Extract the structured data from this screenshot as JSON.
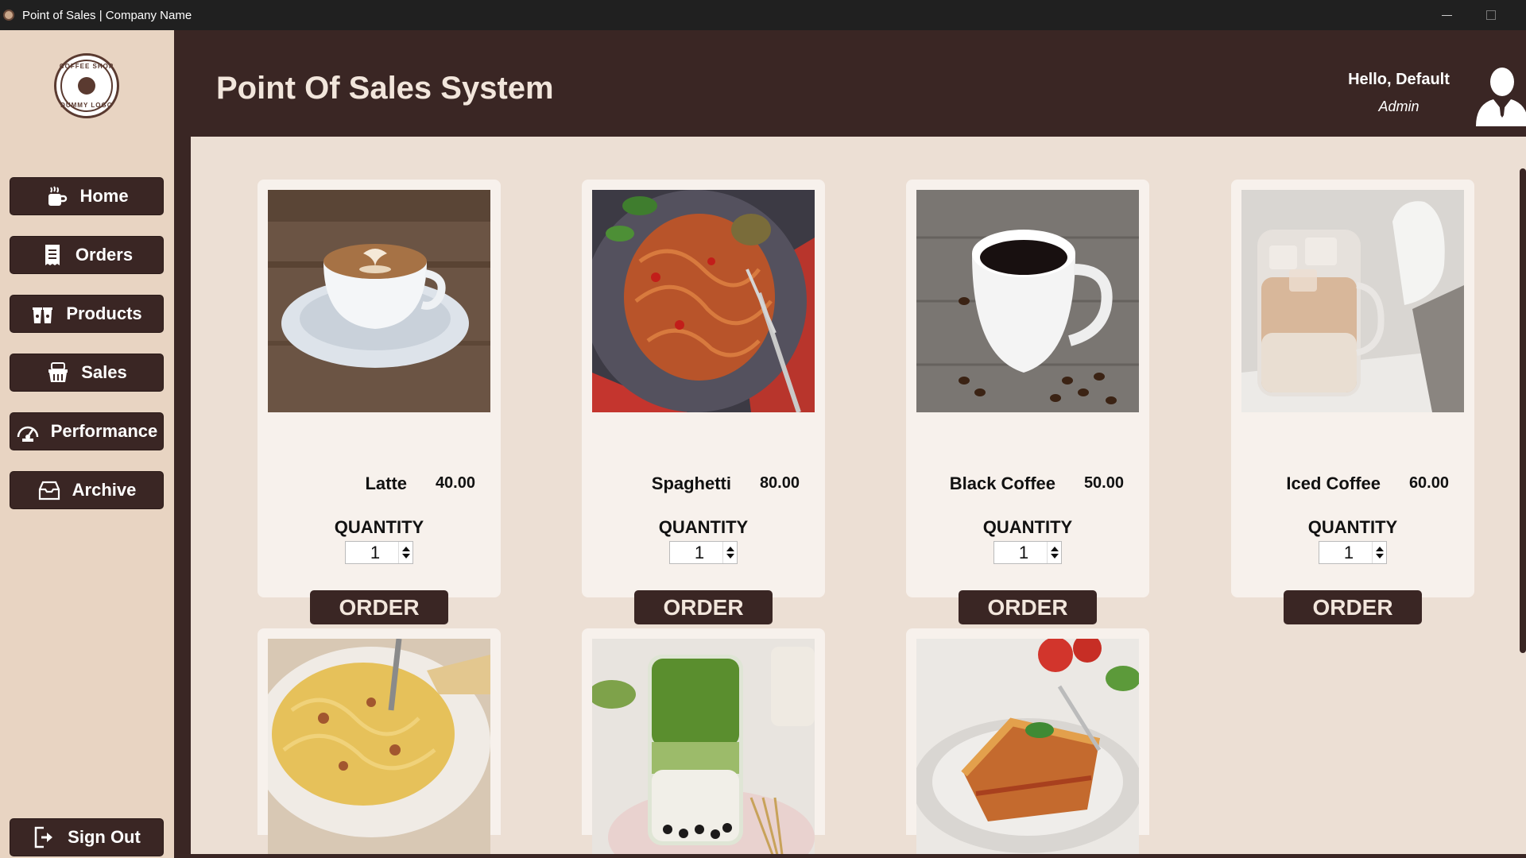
{
  "window": {
    "title": "Point of Sales | Company Name"
  },
  "logo": {
    "top_text": "COFFEE SHOP",
    "bottom_text": "DUMMY LOGO"
  },
  "sidebar": {
    "items": [
      {
        "label": "Home",
        "icon": "coffee-cup-icon"
      },
      {
        "label": "Orders",
        "icon": "receipt-icon"
      },
      {
        "label": "Products",
        "icon": "drinks-icon"
      },
      {
        "label": "Sales",
        "icon": "basket-icon"
      },
      {
        "label": "Performance",
        "icon": "gauge-icon"
      },
      {
        "label": "Archive",
        "icon": "archive-box-icon"
      }
    ],
    "signout": {
      "label": "Sign Out",
      "icon": "sign-out-icon"
    }
  },
  "header": {
    "title": "Point Of Sales System",
    "greeting": "Hello, Default",
    "role": "Admin",
    "avatar_icon": "user-avatar-icon"
  },
  "products": [
    {
      "name": "Latte",
      "price": "40.00",
      "qty_label": "QUANTITY",
      "qty": "1",
      "order_label": "ORDER"
    },
    {
      "name": "Spaghetti",
      "price": "80.00",
      "qty_label": "QUANTITY",
      "qty": "1",
      "order_label": "ORDER"
    },
    {
      "name": "Black Coffee",
      "price": "50.00",
      "qty_label": "QUANTITY",
      "qty": "1",
      "order_label": "ORDER"
    },
    {
      "name": "Iced Coffee",
      "price": "60.00",
      "qty_label": "QUANTITY",
      "qty": "1",
      "order_label": "ORDER"
    },
    {
      "image": "carbonara-pasta"
    },
    {
      "image": "matcha-boba"
    },
    {
      "image": "lasagna"
    }
  ],
  "colors": {
    "primary_dark": "#3a2624",
    "sidebar_bg": "#e8d4c2",
    "main_bg": "#ecdfd4",
    "card_bg": "#f7f1ec",
    "accent_text": "#f2e6dc"
  }
}
